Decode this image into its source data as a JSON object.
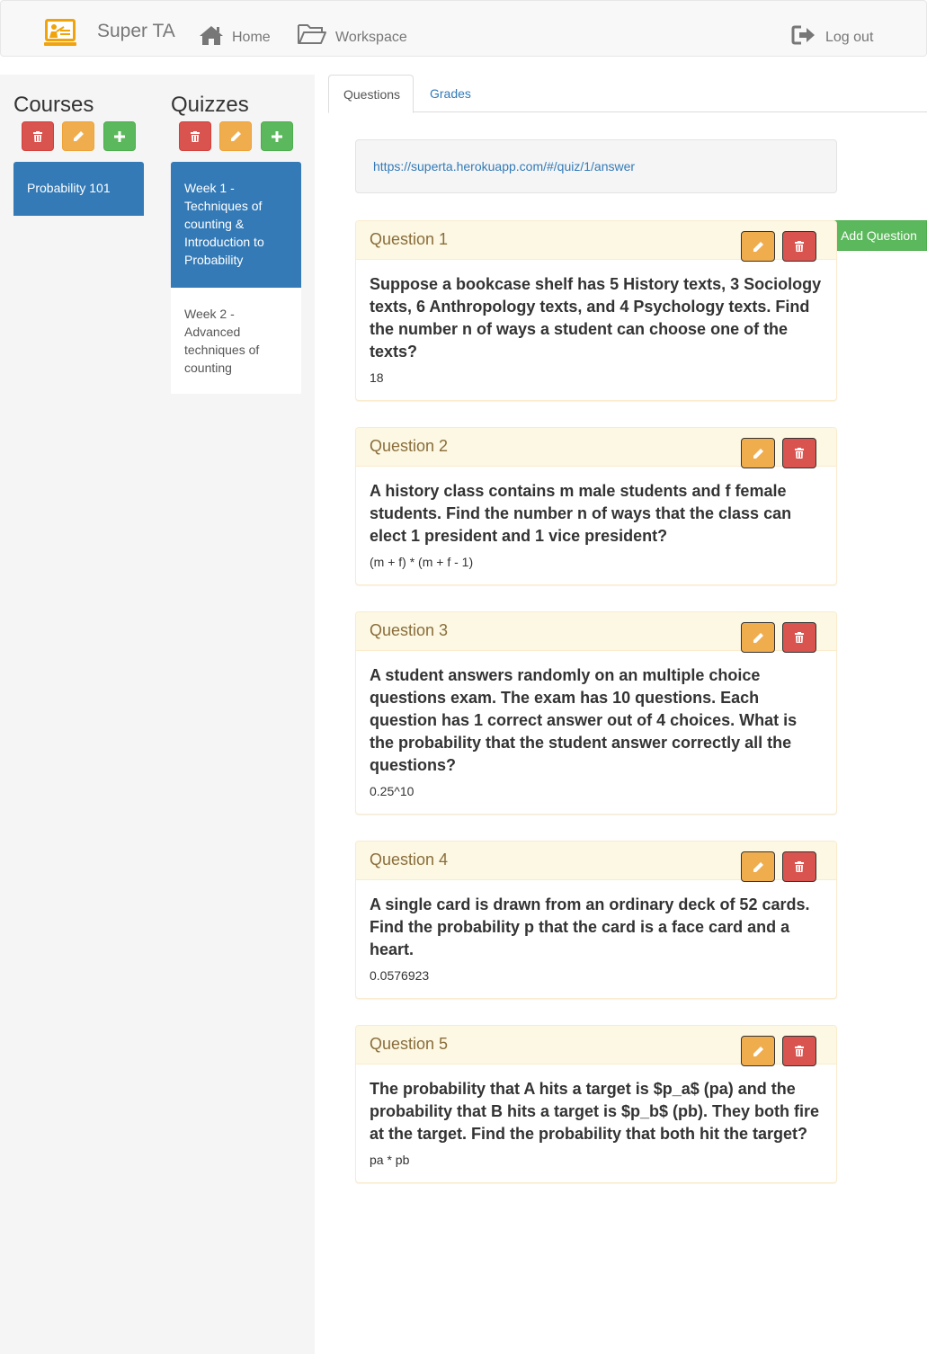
{
  "navbar": {
    "brand": "Super TA",
    "home": "Home",
    "workspace": "Workspace",
    "logout": "Log out"
  },
  "sidebar": {
    "courses_title": "Courses",
    "quizzes_title": "Quizzes",
    "courses": [
      {
        "label": "Probability 101"
      }
    ],
    "quizzes": [
      {
        "label": "Week 1 - Techniques of counting & Introduction to Probability"
      },
      {
        "label": "Week 2 - Advanced techniques of counting"
      }
    ]
  },
  "tabs": {
    "questions": "Questions",
    "grades": "Grades"
  },
  "url": "https://superta.herokuapp.com/#/quiz/1/answer",
  "add_question": "Add Question",
  "questions": [
    {
      "title": "Question 1",
      "text": "Suppose a bookcase shelf has 5 History texts, 3 Sociology texts, 6 Anthropology texts, and 4 Psychology texts. Find the number n of ways a student can choose one of the texts?",
      "answer": "18"
    },
    {
      "title": "Question 2",
      "text": "A history class contains m male students and f female students. Find the number n of ways that the class can elect 1 president and 1 vice president?",
      "answer": "(m + f) * (m + f - 1)"
    },
    {
      "title": "Question 3",
      "text": "A student answers randomly on an multiple choice questions exam. The exam has 10 questions. Each question has 1 correct answer out of 4 choices. What is the probability that the student answer correctly all the questions?",
      "answer": "0.25^10"
    },
    {
      "title": "Question 4",
      "text": "A single card is drawn from an ordinary deck of 52 cards. Find the probability p that the card is a face card and a heart.",
      "answer": "0.0576923"
    },
    {
      "title": "Question 5",
      "text": "The probability that A hits a target is $p_a$ (pa) and the probability that B hits a target is $p_b$ (pb). They both fire at the target. Find the probability that both hit the target?",
      "answer": "pa * pb"
    }
  ],
  "colors": {
    "primary": "#337ab7",
    "danger": "#d9534f",
    "warning": "#f0ad4e",
    "success": "#5cb85c",
    "panel_heading": "#fcf8e3"
  }
}
